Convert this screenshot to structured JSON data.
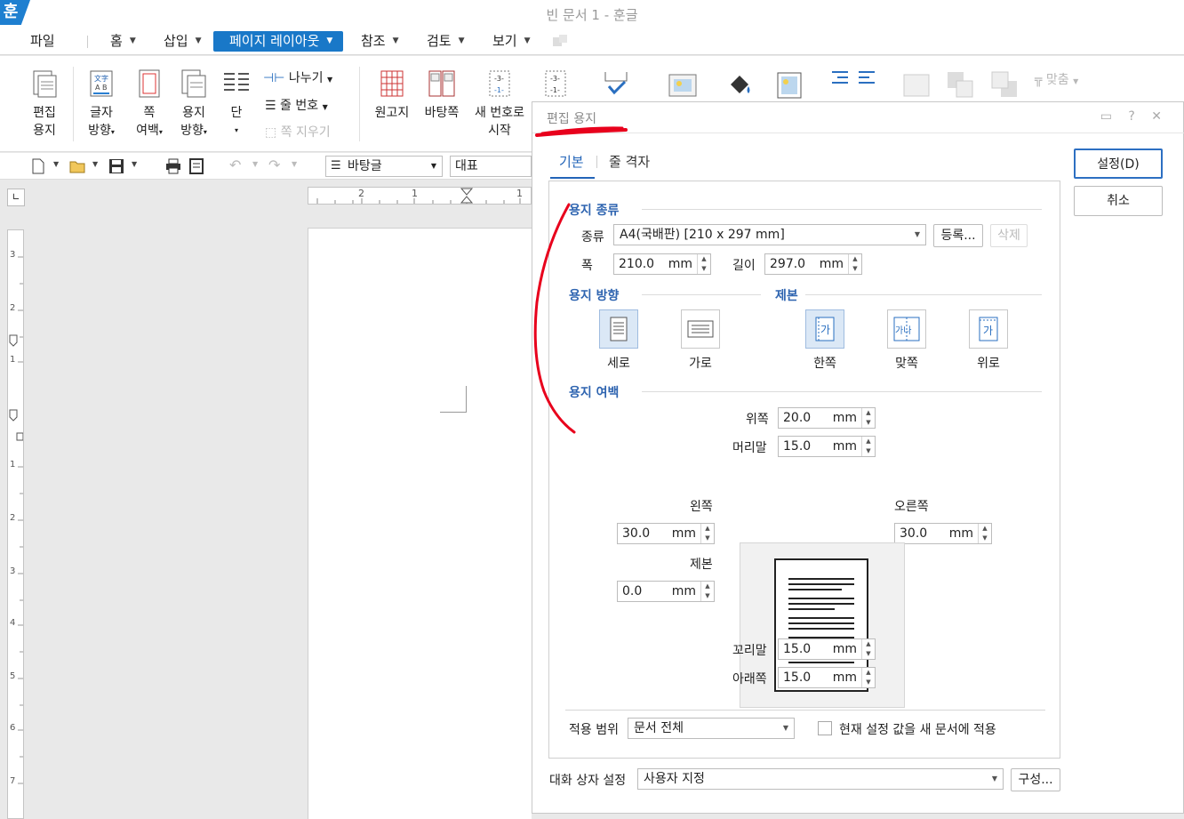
{
  "window": {
    "title": "빈 문서 1 - 훈글",
    "logo_text": "훈"
  },
  "menu": {
    "file": "파일",
    "home": "홈",
    "insert": "삽입",
    "page_layout": "페이지 레이아웃",
    "references": "참조",
    "review": "검토",
    "view": "보기"
  },
  "ribbon": {
    "edit_paper_1": "편집",
    "edit_paper_2": "용지",
    "text_dir_1": "글자",
    "text_dir_2": "방향",
    "margin_1": "쪽",
    "margin_2": "여백",
    "orientation_1": "용지",
    "orientation_2": "방향",
    "columns": "단",
    "split": "나누기",
    "line_number": "줄 번호",
    "delete_page": "쪽 지우기",
    "manuscript": "원고지",
    "master_page": "바탕쪽",
    "new_number_1": "새 번호로",
    "new_number_2": "시작",
    "align_fit": "맞춤"
  },
  "toolbar": {
    "style": "바탕글",
    "font": "대표"
  },
  "dialog": {
    "title": "편집 용지",
    "tabs": [
      "기본",
      "줄 격자"
    ],
    "ok_label": "설정(D)",
    "cancel_label": "취소",
    "paper_type": {
      "section": "용지 종류",
      "type_label": "종류",
      "type_value": "A4(국배판)  [210 x 297 mm]",
      "register": "등록...",
      "delete": "삭제",
      "width_label": "폭",
      "width_value": "210.0",
      "height_label": "길이",
      "height_value": "297.0",
      "unit": "mm"
    },
    "orientation": {
      "section": "용지 방향",
      "portrait": "세로",
      "landscape": "가로"
    },
    "binding": {
      "section": "제본",
      "single": "한쪽",
      "facing": "맞쪽",
      "top": "위로",
      "glyph": "가",
      "glyph_pair": "가나"
    },
    "margin": {
      "section": "용지 여백",
      "top_label": "위쪽",
      "top_value": "20.0",
      "header_label": "머리말",
      "header_value": "15.0",
      "left_label": "왼쪽",
      "left_value": "30.0",
      "right_label": "오른쪽",
      "right_value": "30.0",
      "gutter_label": "제본",
      "gutter_value": "0.0",
      "footer_label": "꼬리말",
      "footer_value": "15.0",
      "bottom_label": "아래쪽",
      "bottom_value": "15.0",
      "unit": "mm"
    },
    "scope": {
      "label": "적용 범위",
      "value": "문서 전체",
      "apply_new_doc": "현재 설정 값을 새 문서에 적용"
    },
    "dialog_setting": {
      "label": "대화 상자 설정",
      "value": "사용자 지정",
      "configure": "구성..."
    }
  },
  "ruler": {
    "h_ticks": [
      "2",
      "1",
      "1"
    ],
    "v_ticks": [
      "3",
      "2",
      "1",
      "1",
      "2",
      "3",
      "4",
      "5",
      "6",
      "7"
    ]
  },
  "colors": {
    "accent": "#1978c8",
    "section_title": "#2e64b0",
    "annotation": "#e8001c"
  }
}
